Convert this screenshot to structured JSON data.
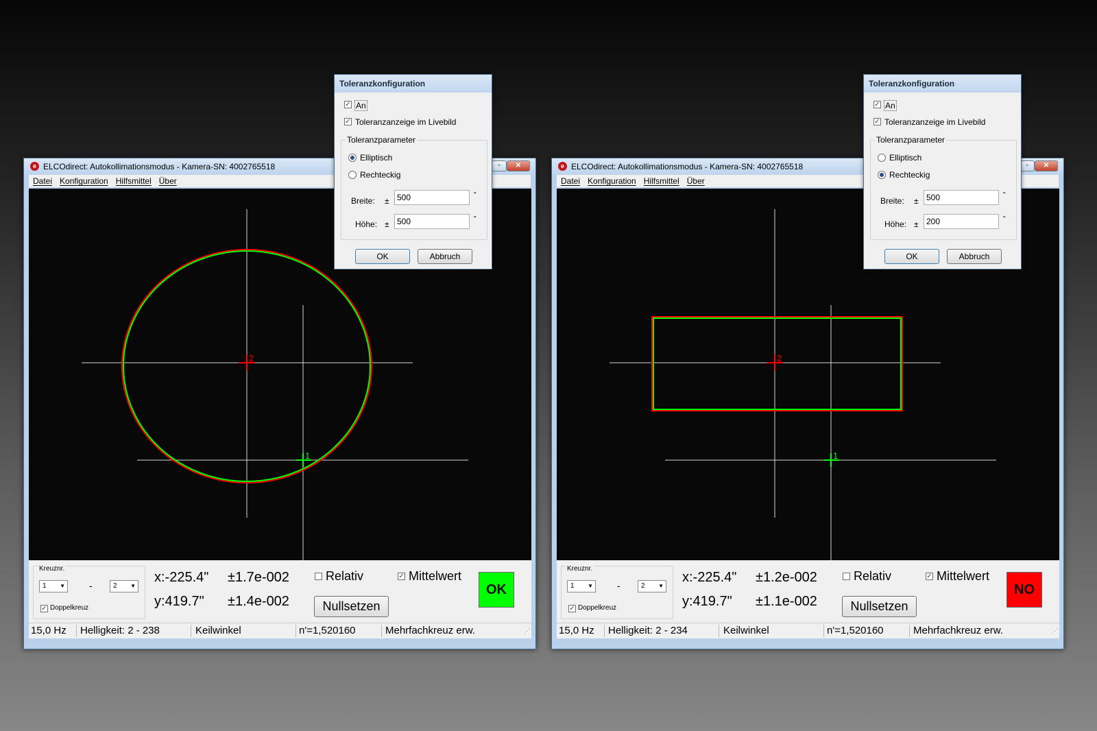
{
  "windows": [
    {
      "title": "ELCOdirect: Autokollimationsmodus - Kamera-SN: 4002765518",
      "menu": [
        "Datei",
        "Konfiguration",
        "Hilfsmittel",
        "Über"
      ],
      "viewport": {
        "cross_a_label": "2",
        "cross_b_label": "1",
        "tolerance_shape": "ellipse",
        "colors": {
          "tolerance_outer": "#ff0000",
          "tolerance_inner": "#00ff00",
          "crosshair": "#d8d8d8",
          "cross_a": "#ff0000",
          "cross_b": "#00ff00"
        }
      },
      "panel": {
        "kreuznr_label": "Kreuznr.",
        "cross_from": "1",
        "cross_to": "2",
        "separator": "-",
        "doppelkreuz_label": "Doppelkreuz",
        "doppelkreuz_checked": true,
        "x_value": "x:-225.4\"",
        "y_value": "y:419.7\"",
        "x_dev": "±1.7e-002",
        "y_dev": "±1.4e-002",
        "relativ_label": "Relativ",
        "relativ_checked": false,
        "mittelwert_label": "Mittelwert",
        "mittelwert_checked": true,
        "nullsetzen_label": "Nullsetzen",
        "verdict_label": "OK",
        "verdict_color": "#00ff00"
      },
      "status": {
        "rate": "15,0 Hz",
        "helligkeit": "Helligkeit: 2 - 238",
        "mode": "Keilwinkel",
        "n": "n'=1,520160",
        "extra": "Mehrfachkreuz erw."
      },
      "dialog": {
        "title": "Toleranzkonfiguration",
        "an_label": "An",
        "an_checked": true,
        "live_label": "Toleranzanzeige im Livebild",
        "live_checked": true,
        "group_title": "Toleranzparameter",
        "option_elliptic": "Elliptisch",
        "option_rect": "Rechteckig",
        "selected": "elliptic",
        "breite_label": "Breite:",
        "hoehe_label": "Höhe:",
        "plusminus": "±",
        "breite_value": "500",
        "hoehe_value": "500",
        "unit": "\"",
        "ok_label": "OK",
        "cancel_label": "Abbruch"
      }
    },
    {
      "title": "ELCOdirect: Autokollimationsmodus - Kamera-SN: 4002765518",
      "menu": [
        "Datei",
        "Konfiguration",
        "Hilfsmittel",
        "Über"
      ],
      "viewport": {
        "cross_a_label": "2",
        "cross_b_label": "1",
        "tolerance_shape": "rectangle",
        "colors": {
          "tolerance_outer": "#ff0000",
          "tolerance_inner": "#00ff00",
          "crosshair": "#d8d8d8",
          "cross_a": "#ff0000",
          "cross_b": "#00ff00"
        }
      },
      "panel": {
        "kreuznr_label": "Kreuznr.",
        "cross_from": "1",
        "cross_to": "2",
        "separator": "-",
        "doppelkreuz_label": "Doppelkreuz",
        "doppelkreuz_checked": true,
        "x_value": "x:-225.4\"",
        "y_value": "y:419.7\"",
        "x_dev": "±1.2e-002",
        "y_dev": "±1.1e-002",
        "relativ_label": "Relativ",
        "relativ_checked": false,
        "mittelwert_label": "Mittelwert",
        "mittelwert_checked": true,
        "nullsetzen_label": "Nullsetzen",
        "verdict_label": "NO",
        "verdict_color": "#ff0000"
      },
      "status": {
        "rate": "15,0 Hz",
        "helligkeit": "Helligkeit: 2 - 234",
        "mode": "Keilwinkel",
        "n": "n'=1,520160",
        "extra": "Mehrfachkreuz erw."
      },
      "dialog": {
        "title": "Toleranzkonfiguration",
        "an_label": "An",
        "an_checked": true,
        "live_label": "Toleranzanzeige im Livebild",
        "live_checked": true,
        "group_title": "Toleranzparameter",
        "option_elliptic": "Elliptisch",
        "option_rect": "Rechteckig",
        "selected": "rect",
        "breite_label": "Breite:",
        "hoehe_label": "Höhe:",
        "plusminus": "±",
        "breite_value": "500",
        "hoehe_value": "200",
        "unit": "\"",
        "ok_label": "OK",
        "cancel_label": "Abbruch"
      }
    }
  ]
}
